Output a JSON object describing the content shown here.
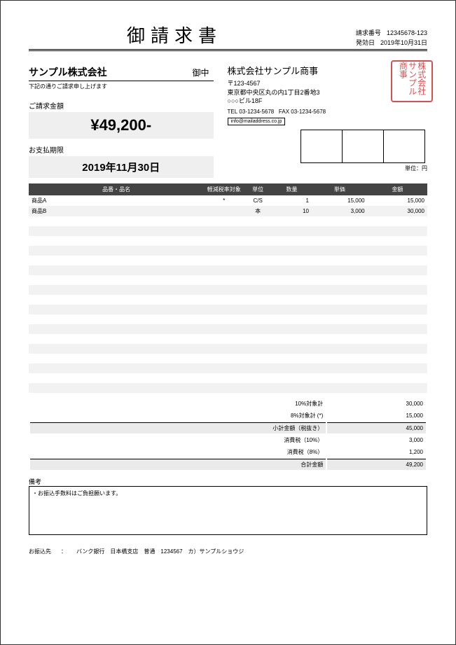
{
  "doc": {
    "title": "御請求書",
    "invoice_no_label": "請求番号",
    "invoice_no": "12345678-123",
    "issue_date_label": "発効日",
    "issue_date": "2019年10月31日"
  },
  "client": {
    "name": "サンプル株式会社",
    "suffix": "御中",
    "note": "下記の通りご請求申し上げます"
  },
  "amount": {
    "label": "ご請求金額",
    "value": "¥49,200-"
  },
  "deadline": {
    "label": "お支払期限",
    "value": "2019年11月30日"
  },
  "sender": {
    "name": "株式会社サンプル商事",
    "postal": "〒123-4567",
    "addr1": "東京都中央区丸の内1丁目2番地3",
    "addr2": "○○○ビル18F",
    "tel_label": "TEL",
    "tel": "03-1234-5678",
    "fax_label": "FAX",
    "fax": "03-1234-5678",
    "email": "info@mailaddress.co.jp",
    "stamp_text": "株式会社サンプル商事"
  },
  "table": {
    "unit_note": "単位：円",
    "headers": {
      "name": "品番・品名",
      "tax": "軽減税率対象",
      "unit": "単位",
      "qty": "数量",
      "price": "単価",
      "amount": "金額"
    },
    "rows": [
      {
        "name": "商品A",
        "tax": "*",
        "unit": "C/S",
        "qty": "1",
        "price": "15,000",
        "amount": "15,000"
      },
      {
        "name": "商品B",
        "tax": "",
        "unit": "本",
        "qty": "10",
        "price": "3,000",
        "amount": "30,000"
      }
    ],
    "blank_rows": 18
  },
  "summary": {
    "sub10_label": "10%対象計",
    "sub10": "30,000",
    "sub8_label": "8%対象計 (*)",
    "sub8": "15,000",
    "subtotal_label": "小計金額（税抜き）",
    "subtotal": "45,000",
    "tax10_label": "消費税（10%）",
    "tax10": "3,000",
    "tax8_label": "消費税（8%）",
    "tax8": "1,200",
    "total_label": "合計金額",
    "total": "49,200"
  },
  "remarks": {
    "label": "備考",
    "text": "・お振込手数料はご負担願います。"
  },
  "bank": {
    "label": "お振込先",
    "sep": "：",
    "text": "バンク銀行　日本橋支店　普通　1234567　カ）サンプルショウジ"
  }
}
